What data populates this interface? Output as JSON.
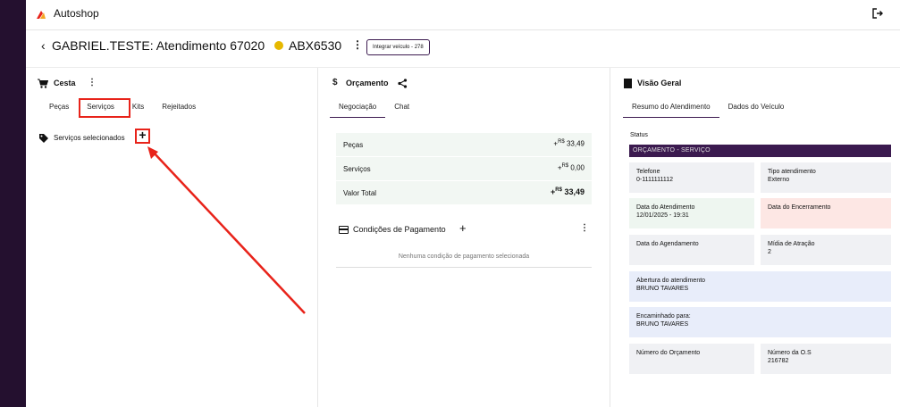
{
  "app": {
    "title": "Autoshop",
    "brand_color": "#e8231a",
    "rail_color": "#24102f"
  },
  "header": {
    "title": "GABRIEL.TESTE: Atendimento 67020",
    "plate": "ABX6530",
    "status_dot_color": "#e6b800",
    "integrar_button": "Integrar veículo - 278"
  },
  "cesta": {
    "title": "Cesta",
    "tabs": [
      {
        "label": "Peças",
        "active": false
      },
      {
        "label": "Serviços",
        "active": true
      },
      {
        "label": "Kits",
        "active": false
      },
      {
        "label": "Rejeitados",
        "active": false
      }
    ],
    "selected_label": "Serviços selecionados",
    "add_icon": "plus"
  },
  "orcamento": {
    "title": "Orçamento",
    "tabs": [
      {
        "label": "Negociação",
        "active": true
      },
      {
        "label": "Chat",
        "active": false
      }
    ],
    "rows": [
      {
        "label": "Peças",
        "prefix": "+",
        "currency": "R$",
        "value": "33,49"
      },
      {
        "label": "Serviços",
        "prefix": "+",
        "currency": "R$",
        "value": "0,00"
      },
      {
        "label": "Valor Total",
        "prefix": "+",
        "currency": "R$",
        "value": "33,49"
      }
    ],
    "conditions_title": "Condições de Pagamento",
    "no_conditions": "Nenhuma condição de pagamento selecionada"
  },
  "visao": {
    "title": "Visão Geral",
    "tabs": [
      {
        "label": "Resumo do Atendimento",
        "active": true
      },
      {
        "label": "Dados do Veículo",
        "active": false
      }
    ],
    "status_label": "Status",
    "status_value": "ORÇAMENTO - SERVIÇO",
    "telefone_label": "Telefone",
    "telefone_value": "0-1111111112",
    "tipo_label": "Tipo atendimento",
    "tipo_value": "Externo",
    "data_atendimento_label": "Data do Atendimento",
    "data_atendimento_value": "12/01/2025 - 19:31",
    "data_encerramento_label": "Data do Encerramento",
    "data_agendamento_label": "Data do Agendamento",
    "midia_label": "Mídia de Atração",
    "midia_value": "2",
    "abertura_label": "Abertura do atendimento",
    "abertura_value": "BRUNO TAVARES",
    "encaminhado_label": "Encaminhado para:",
    "encaminhado_value": "BRUNO TAVARES",
    "num_orcamento_label": "Número do Orçamento",
    "num_os_label": "Número da O.S",
    "num_os_value": "216782"
  }
}
